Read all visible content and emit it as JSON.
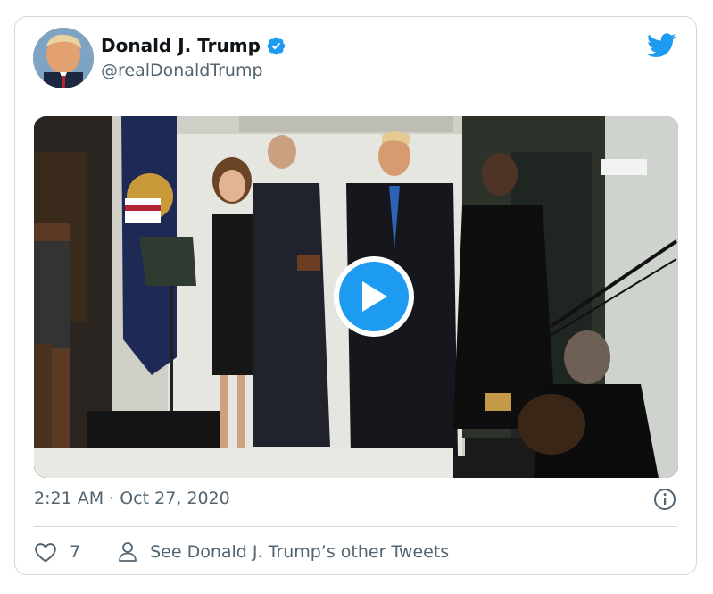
{
  "tweet": {
    "author_name": "Donald J. Trump",
    "author_handle": "@realDonaldTrump",
    "timestamp": "2:21 AM · Oct 27, 2020",
    "like_count": "7",
    "other_tweets_label": "See Donald J. Trump’s other Tweets"
  },
  "colors": {
    "brand_blue": "#1d9bf0",
    "secondary_text": "#536471",
    "border": "#cfd9de"
  },
  "icons": [
    "verified-badge-icon",
    "twitter-bird-icon",
    "play-icon",
    "info-icon",
    "heart-icon",
    "person-icon"
  ]
}
